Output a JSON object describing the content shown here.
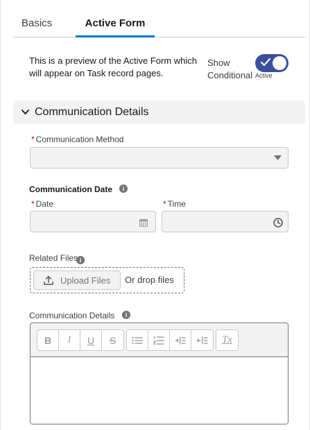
{
  "tabs": [
    {
      "label": "Basics"
    },
    {
      "label": "Active Form"
    }
  ],
  "preview": {
    "description": "This is a preview of the Active Form which will appear on Task record pages.",
    "show_conditional": "Show Conditional",
    "toggle_state": "Active"
  },
  "section": {
    "title": "Communication Details"
  },
  "fields": {
    "required_mark": "*",
    "communication_method": {
      "label": "Communication Method",
      "value": ""
    },
    "communication_date": {
      "label": "Communication Date"
    },
    "date": {
      "label": "Date",
      "value": ""
    },
    "time": {
      "label": "Time",
      "value": ""
    },
    "related_files": {
      "label": "Related Files",
      "upload_label": "Upload Files",
      "drop_text": "Or drop files"
    },
    "communication_details": {
      "label": "Communication Details",
      "value": ""
    }
  },
  "info_glyph": "i",
  "toolbar": {
    "bold": "B",
    "italic": "I",
    "underline": "U",
    "strike": "S",
    "clear": "Tx"
  },
  "colors": {
    "required": "#ba0517",
    "toggle_on": "#3b4fa0",
    "tab_underline": "#0176d3"
  }
}
